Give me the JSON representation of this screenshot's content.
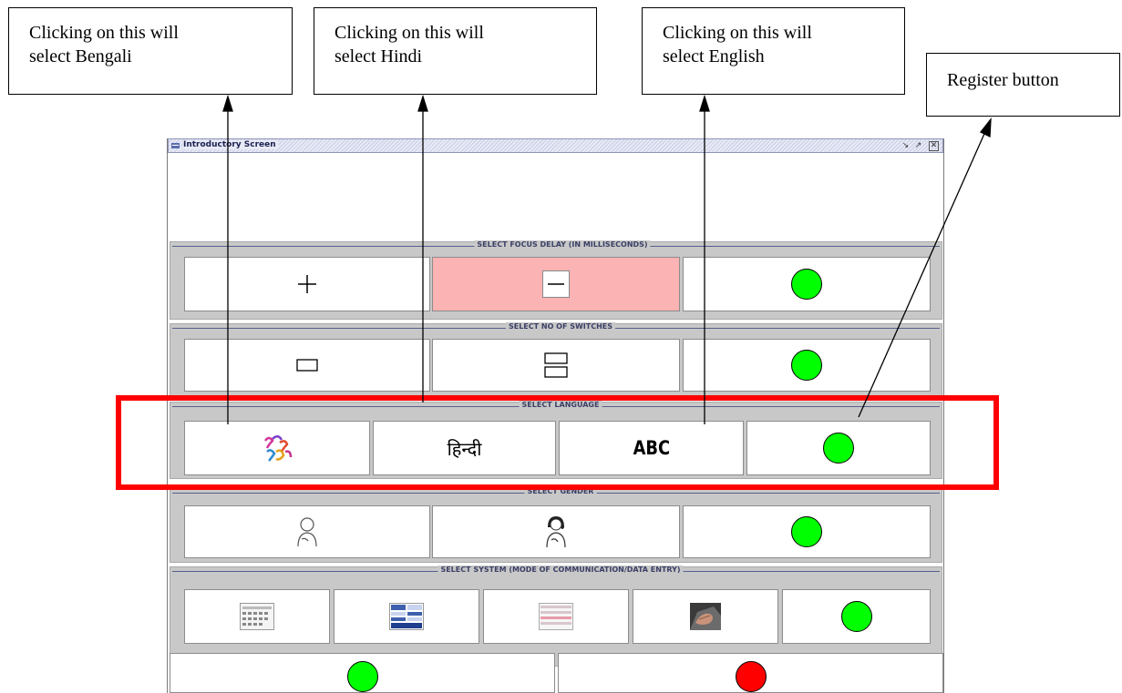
{
  "callouts": {
    "bengali": "Clicking on this will\nselect Bengali",
    "hindi": "Clicking on this will\nselect Hindi",
    "english": "Clicking on this will\nselect English",
    "register": "Register button"
  },
  "window": {
    "title": "Introductory Screen",
    "controls": [
      "minimize",
      "maximize",
      "close"
    ]
  },
  "sections": {
    "focus_delay": {
      "legend": "SELECT FOCUS DELAY (IN MILLISECONDS)"
    },
    "switches": {
      "legend": "SELECT NO OF SWITCHES"
    },
    "language": {
      "legend": "SELECT LANGUAGE",
      "hindi_label": "हिन्दी",
      "english_label": "ABC"
    },
    "gender": {
      "legend": "SELECT GENDER"
    },
    "system": {
      "legend": "SELECT SYSTEM (MODE OF COMMUNICATION/DATA ENTRY)"
    }
  },
  "colors": {
    "register_button": "#00ff00",
    "cancel_button": "#ff0000",
    "selected_cell": "#fbb3b3",
    "highlight_box": "#ff0000"
  },
  "icons": [
    "plus-icon",
    "minus-icon",
    "single-switch-icon",
    "double-switch-icon",
    "bengali-script-icon",
    "male-icon",
    "female-icon",
    "keyboard-layout-icon",
    "table-layout-icon",
    "list-layout-icon",
    "hand-typing-icon"
  ]
}
